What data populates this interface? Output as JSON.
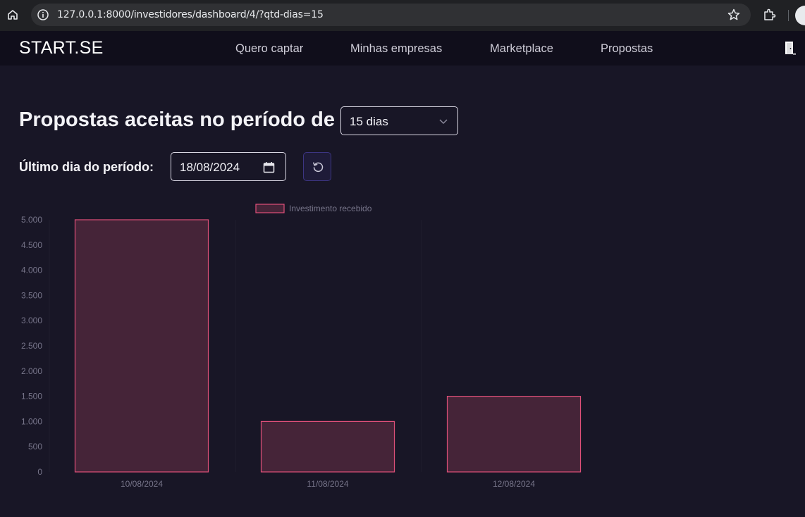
{
  "browser": {
    "url": "127.0.0.1:8000/investidores/dashboard/4/?qtd-dias=15"
  },
  "nav": {
    "brand": "START.SE",
    "links": [
      "Quero captar",
      "Minhas empresas",
      "Marketplace",
      "Propostas"
    ],
    "exit_icon": "door-exit-icon"
  },
  "filters": {
    "title": "Propostas aceitas no período de",
    "period_selected": "15 dias",
    "date_label": "Último dia do período:",
    "date_value": "18/08/2024",
    "refresh_icon": "refresh-icon"
  },
  "colors": {
    "accent": "#e0507a",
    "bar_fill": "#452438",
    "background": "#181626"
  },
  "chart_data": {
    "type": "bar",
    "categories": [
      "10/08/2024",
      "11/08/2024",
      "12/08/2024"
    ],
    "series": [
      {
        "name": "Investimento recebido",
        "values": [
          5000,
          1000,
          1500
        ]
      }
    ],
    "ylim": [
      0,
      5000
    ],
    "yticks": [
      "0",
      "500",
      "1.000",
      "1.500",
      "2.000",
      "2.500",
      "3.000",
      "3.500",
      "4.000",
      "4.500",
      "5.000"
    ],
    "legend": "top",
    "grid": false
  }
}
